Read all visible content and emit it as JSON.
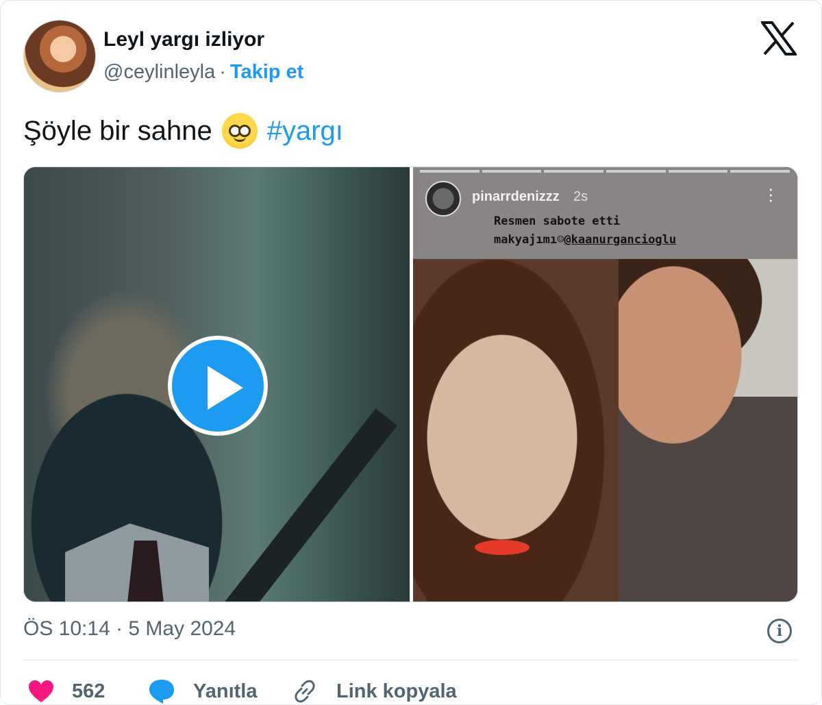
{
  "author": {
    "display_name": "Leyl yargı izliyor",
    "handle": "@ceylinleyla",
    "separator": "·",
    "follow_label": "Takip et"
  },
  "tweet": {
    "text": "Şöyle bir sahne",
    "emoji": "🥹",
    "hashtag": "#yargı",
    "timestamp": "ÖS 10:14 · 5 May 2024"
  },
  "media": {
    "story": {
      "username": "pinarrdenizzz",
      "time": "2s",
      "caption_line1": "Resmen sabote etti",
      "caption_line2": "makyajımı",
      "mention": "@kaanurgancioglu"
    }
  },
  "actions": {
    "like_count": "562",
    "reply_label": "Yanıtla",
    "copy_link_label": "Link kopyala"
  },
  "colors": {
    "accent": "#1d9bf0",
    "like": "#f91880",
    "muted": "#536471"
  }
}
